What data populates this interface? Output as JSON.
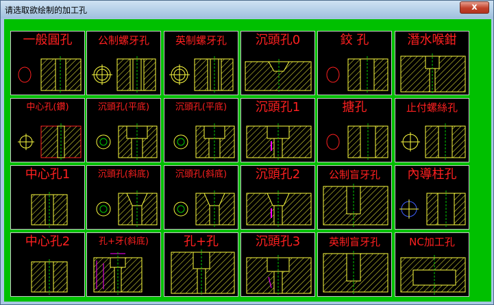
{
  "window": {
    "title": "请选取欲绘制的加工孔",
    "close_glyph": "x"
  },
  "colors": {
    "tile_bg": "#000000",
    "label": "#ff2020",
    "drawing": "#ffff40",
    "accent": "#ff00ff",
    "center": "#00cc00",
    "panel": "#00c000"
  },
  "tiles": [
    {
      "label": "一般圓孔",
      "icon": "plain-hole-icon"
    },
    {
      "label": "公制螺牙孔",
      "icon": "metric-tap-icon"
    },
    {
      "label": "英制螺牙孔",
      "icon": "inch-tap-icon"
    },
    {
      "label": "沉頭孔0",
      "icon": "counterbore-0-icon"
    },
    {
      "label": "鉸 孔",
      "icon": "reamed-hole-icon"
    },
    {
      "label": "潛水喉鉗",
      "icon": "plug-hole-icon"
    },
    {
      "label": "中心孔(鑽)",
      "icon": "center-drill-icon"
    },
    {
      "label": "沉頭孔(平底)",
      "icon": "counterbore-flat-icon"
    },
    {
      "label": "沉頭孔(平底)",
      "icon": "counterbore-flat-2-icon"
    },
    {
      "label": "沉頭孔1",
      "icon": "counterbore-1-icon"
    },
    {
      "label": "搪孔",
      "icon": "boring-icon"
    },
    {
      "label": "止付螺絲孔",
      "icon": "setscrew-hole-icon"
    },
    {
      "label": "中心孔1",
      "icon": "center-hole-1-icon"
    },
    {
      "label": "沉頭孔(斜底)",
      "icon": "countersink-angled-icon"
    },
    {
      "label": "沉頭孔(斜底)",
      "icon": "countersink-angled-2-icon"
    },
    {
      "label": "沉頭孔2",
      "icon": "counterbore-2-icon"
    },
    {
      "label": "公制盲牙孔",
      "icon": "metric-blind-tap-icon"
    },
    {
      "label": "內導柱孔",
      "icon": "guide-pillar-hole-icon"
    },
    {
      "label": "中心孔2",
      "icon": "center-hole-2-icon"
    },
    {
      "label": "孔+牙(斜底)",
      "icon": "hole-tap-angled-icon"
    },
    {
      "label": "孔+孔",
      "icon": "hole-hole-icon"
    },
    {
      "label": "沉頭孔3",
      "icon": "counterbore-3-icon"
    },
    {
      "label": "英制盲牙孔",
      "icon": "inch-blind-tap-icon"
    },
    {
      "label": "NC加工孔",
      "icon": "nc-pocket-icon"
    }
  ]
}
